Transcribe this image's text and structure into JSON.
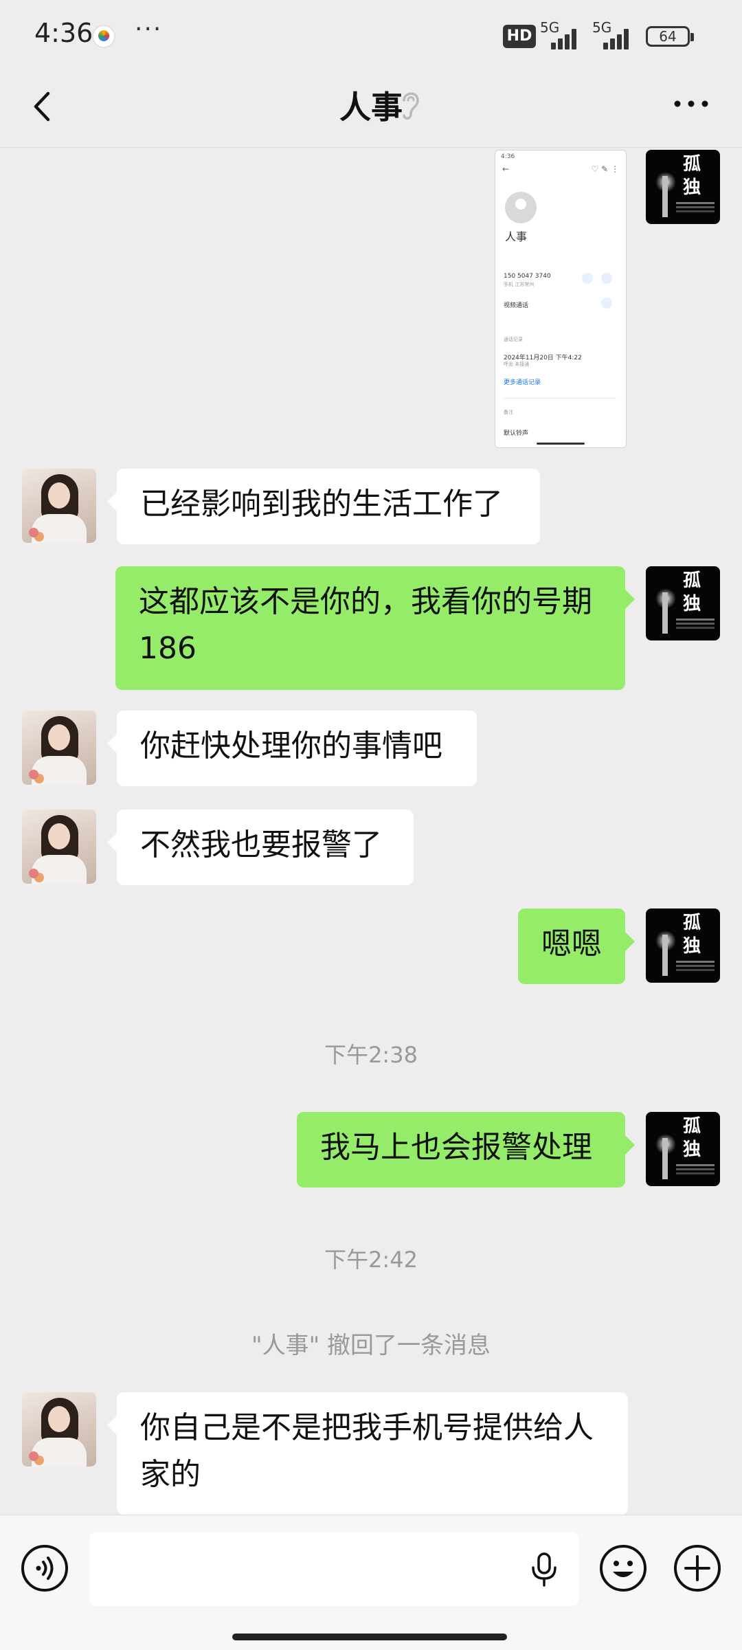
{
  "status_bar": {
    "time": "4:36",
    "more": "···",
    "hd_label": "HD",
    "signal1_label": "5G",
    "signal2_label": "5G",
    "battery_level": "64"
  },
  "header": {
    "title": "人事",
    "back_icon": "chevron-left-icon",
    "ear_icon": "ear-icon",
    "menu_icon": "more-dots-icon"
  },
  "screenshot_message": {
    "contact_name": "人事",
    "phone": "150 5047 3740",
    "phone_sub": "手机 江苏常州",
    "video_call": "视频通话",
    "section": "通话记录",
    "call_time": "2024年11月20日 下午4:22",
    "call_sub": "呼出 未接通",
    "more_records": "更多通话记录",
    "notes_label": "备注",
    "default_ringtone": "默认铃声"
  },
  "messages": [
    {
      "side": "in",
      "text": "已经影响到我的生活工作了"
    },
    {
      "side": "out",
      "text": "这都应该不是你的，我看你的号期186"
    },
    {
      "side": "in",
      "text": "你赶快处理你的事情吧"
    },
    {
      "side": "in",
      "text": "不然我也要报警了"
    },
    {
      "side": "out",
      "text": "嗯嗯"
    },
    {
      "side": "out",
      "text": "我马上也会报警处理"
    },
    {
      "side": "in",
      "text": "你自己是不是把我手机号提供给人家的"
    }
  ],
  "timestamps": [
    "下午2:38",
    "下午2:42"
  ],
  "recall_notice": "\"人事\" 撤回了一条消息",
  "my_avatar_text": "孤独",
  "input_bar": {
    "voice_icon": "voice-mode-icon",
    "mic_icon": "microphone-icon",
    "emoji_icon": "emoji-icon",
    "plus_icon": "plus-icon"
  },
  "colors": {
    "background": "#EDEDED",
    "outgoing_bubble": "#95EC69",
    "incoming_bubble": "#FFFFFF",
    "timestamp_text": "#999999"
  }
}
